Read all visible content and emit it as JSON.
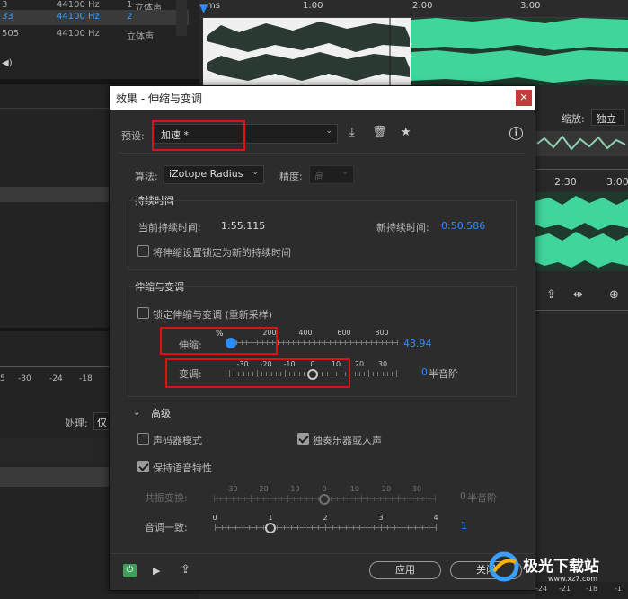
{
  "files": {
    "rows": [
      {
        "id": "3",
        "rate": "44100 Hz",
        "ch": "1",
        "label": "立体声"
      },
      {
        "id": "33",
        "rate": "44100 Hz",
        "ch": "2",
        "label": ""
      },
      {
        "id": "505",
        "rate": "44100 Hz",
        "ch": "",
        "label": "立体声"
      }
    ]
  },
  "left_panel": {
    "meter_ticks": [
      "5",
      "-30",
      "-24",
      "-18"
    ],
    "process_label": "处理:",
    "process_value": "仅"
  },
  "timeline": {
    "ruler_labels": [
      "ms",
      "1:00",
      "2:00",
      "3:00"
    ],
    "lower_ruler_labels": [
      "2:30",
      "3:00"
    ],
    "zoom_label": "缩放:",
    "zoom_value": "独立",
    "bottom_ticks": [
      "-24",
      "-21",
      "-18",
      "-1"
    ]
  },
  "dialog": {
    "title": "效果 - 伸缩与变调",
    "close": "×",
    "preset_label": "预设:",
    "preset_value": "加速 *",
    "algorithm_label": "算法:",
    "algorithm_value": "iZotope Radius",
    "precision_label": "精度:",
    "precision_value": "高",
    "duration": {
      "title": "持续时间",
      "current_label": "当前持续时间:",
      "current_value": "1:55.115",
      "new_label": "新持续时间:",
      "new_value": "0:50.586",
      "lock_label": "将伸缩设置锁定为新的持续时间",
      "lock_checked": false
    },
    "stretch_pitch": {
      "title": "伸缩与变调",
      "lock_label": "锁定伸缩与变调 (重新采样)",
      "lock_checked": false,
      "stretch_label": "伸缩:",
      "stretch_unit": "%",
      "stretch_ticks": [
        "200",
        "400",
        "600",
        "800"
      ],
      "stretch_value": "43.94",
      "stretch_fraction": 0.0,
      "pitch_label": "变调:",
      "pitch_ticks": [
        "-30",
        "-20",
        "-10",
        "0",
        "10",
        "20",
        "30"
      ],
      "pitch_value": "0",
      "pitch_unit": "半音阶",
      "pitch_fraction": 0.5
    },
    "advanced": {
      "title": "高级",
      "vocoder_label": "声码器模式",
      "vocoder_checked": false,
      "solo_label": "独奏乐器或人声",
      "solo_checked": true,
      "preserve_label": "保持语音特性",
      "preserve_checked": true,
      "formant_label": "共振变换:",
      "formant_ticks": [
        "-30",
        "-20",
        "-10",
        "0",
        "10",
        "20",
        "30"
      ],
      "formant_value": "0",
      "formant_unit": "半音阶",
      "formant_fraction": 0.5,
      "pitch_coherence_label": "音调一致:",
      "pitch_coherence_ticks": [
        "0",
        "1",
        "2",
        "3",
        "4"
      ],
      "pitch_coherence_value": "1",
      "pitch_coherence_fraction": 0.25
    },
    "footer": {
      "apply": "应用",
      "close": "关闭"
    }
  },
  "watermark": {
    "text": "极光下载站",
    "url": "www.xz7.com"
  },
  "colors": {
    "accent_blue": "#2f8cff",
    "waveform_green": "#3fd59b",
    "highlight_red": "#e01010"
  }
}
